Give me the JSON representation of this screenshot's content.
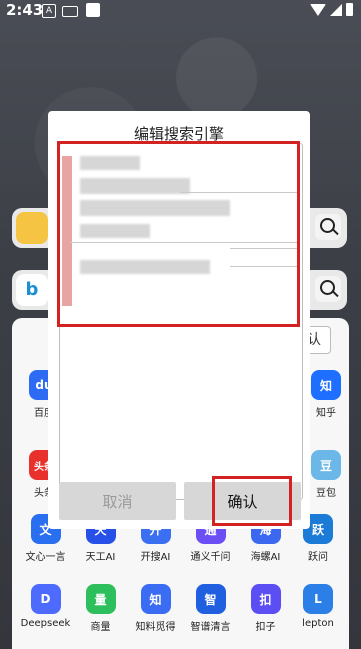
{
  "status_bar": {
    "time": "2:43",
    "indicator_a": "A"
  },
  "dialog": {
    "title": "编辑搜索引擎",
    "cancel_label": "取消",
    "confirm_label": "确认"
  },
  "edge_button_label": "认",
  "apps_row1": [
    {
      "label": "百度",
      "icon": "du",
      "color": "#2d6bf5"
    },
    {
      "label": "头条",
      "icon": "头条",
      "color": "#e8312d"
    }
  ],
  "right_side": [
    {
      "label": "知乎",
      "icon": "知",
      "color": "#1e6fff"
    },
    {
      "label": "豆包",
      "icon": "豆",
      "color": "#6bb8e8"
    }
  ],
  "apps_row3": [
    {
      "label": "文心一言",
      "icon": "文",
      "color": "#2a6ff0"
    },
    {
      "label": "天工AI",
      "icon": "天",
      "color": "#2650e8"
    },
    {
      "label": "开搜AI",
      "icon": "开",
      "color": "#3b6ff2"
    },
    {
      "label": "通义千问",
      "icon": "通",
      "color": "#6b4ff5"
    },
    {
      "label": "海螺AI",
      "icon": "海",
      "color": "#3c68f0"
    },
    {
      "label": "跃问",
      "icon": "跃",
      "color": "#1d7bd8"
    }
  ],
  "apps_row4": [
    {
      "label": "Deepseek",
      "icon": "D",
      "color": "#4d6bfe"
    },
    {
      "label": "商量",
      "icon": "量",
      "color": "#2dbf5c"
    },
    {
      "label": "知料觅得",
      "icon": "知",
      "color": "#3a6cf4"
    },
    {
      "label": "智谱清言",
      "icon": "智",
      "color": "#1f5fe0"
    },
    {
      "label": "扣子",
      "icon": "扣",
      "color": "#5b4ef2"
    },
    {
      "label": "lepton",
      "icon": "L",
      "color": "#2b7fe6"
    }
  ]
}
